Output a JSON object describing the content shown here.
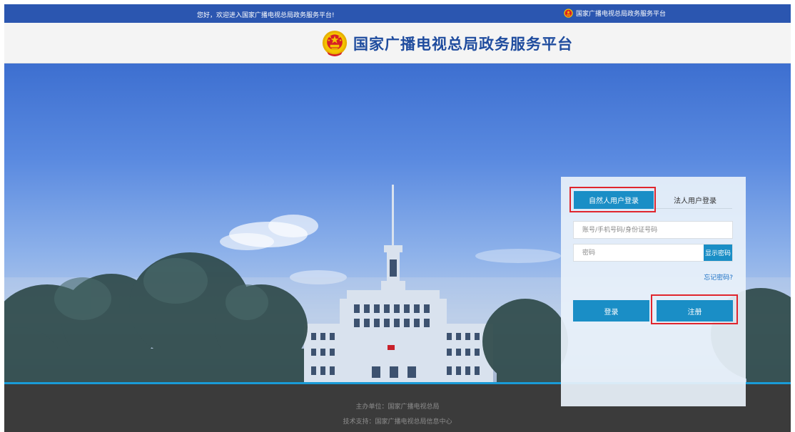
{
  "topbar": {
    "welcome": "您好，欢迎进入国家广播电视总局政务服务平台!",
    "right_label": "国家广播电视总局政务服务平台"
  },
  "header": {
    "title": "国家广播电视总局政务服务平台"
  },
  "login": {
    "tab_natural": "自然人用户登录",
    "tab_legal": "法人用户登录",
    "account_placeholder": "账号/手机号码/身份证号码",
    "password_placeholder": "密码",
    "show_password": "显示密码",
    "forgot_password": "忘记密码?",
    "login_button": "登录",
    "register_button": "注册"
  },
  "footer": {
    "host": "主办单位：国家广播电视总局",
    "support": "技术支持：国家广播电视总局信息中心"
  },
  "colors": {
    "topbar": "#2b56b0",
    "brand_title": "#1f4c9e",
    "accent": "#1a8ec6",
    "highlight": "#e0252d",
    "footer": "#3b3b3b"
  },
  "icons": {
    "emblem": "national-emblem-icon"
  }
}
